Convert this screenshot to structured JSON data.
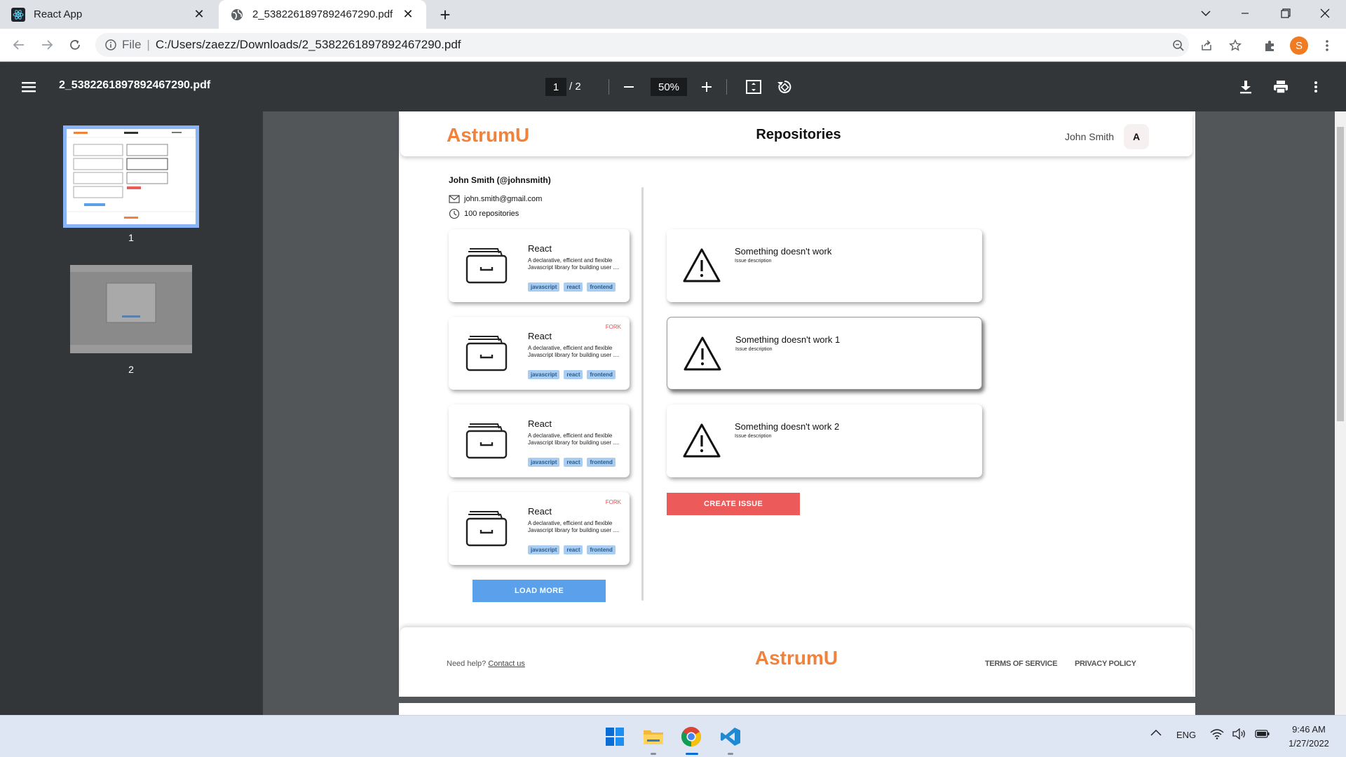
{
  "browser": {
    "tabs": [
      {
        "title": "React App",
        "active": false
      },
      {
        "title": "2_5382261897892467290.pdf",
        "active": true
      }
    ],
    "address": {
      "scheme_label": "File",
      "path": "C:/Users/zaezz/Downloads/2_5382261897892467290.pdf"
    },
    "profile_initial": "S"
  },
  "pdf_viewer": {
    "filename": "2_5382261897892467290.pdf",
    "current_page": "1",
    "total_pages": "/ 2",
    "zoom": "50%",
    "thumbnails": [
      {
        "label": "1",
        "selected": true
      },
      {
        "label": "2",
        "selected": false
      }
    ]
  },
  "document": {
    "header": {
      "logo": "AstrumU",
      "title": "Repositories",
      "user_name": "John Smith",
      "avatar_initial": "A"
    },
    "profile": {
      "name": "John Smith (@johnsmith)",
      "email": "john.smith@gmail.com",
      "repo_count": "100 repositories"
    },
    "repos": [
      {
        "name": "React",
        "description": "A declarative, efficient and flexible Javascript library for building user ....",
        "fork": "",
        "tags": [
          "javascript",
          "react",
          "frontend"
        ]
      },
      {
        "name": "React",
        "description": "A declarative, efficient and flexible Javascript library for building user ....",
        "fork": "FORK",
        "tags": [
          "javascript",
          "react",
          "frontend"
        ]
      },
      {
        "name": "React",
        "description": "A declarative, efficient and flexible Javascript library for building user ....",
        "fork": "",
        "tags": [
          "javascript",
          "react",
          "frontend"
        ]
      },
      {
        "name": "React",
        "description": "A declarative, efficient and flexible Javascript library for building user ....",
        "fork": "FORK",
        "tags": [
          "javascript",
          "react",
          "frontend"
        ]
      }
    ],
    "load_more": "LOAD MORE",
    "issues": [
      {
        "title": "Something doesn't work",
        "description": "Issue description"
      },
      {
        "title": "Something doesn't work 1",
        "description": "Issue description"
      },
      {
        "title": "Something doesn't work 2",
        "description": "Issue description"
      }
    ],
    "create_issue": "CREATE ISSUE",
    "footer": {
      "help_text": "Need help?",
      "help_link": "Contact us",
      "logo": "AstrumU",
      "terms": "TERMS OF SERVICE",
      "privacy": "PRIVACY POLICY"
    }
  },
  "taskbar": {
    "apps": [
      "start-icon",
      "file-explorer-icon",
      "chrome-icon",
      "vscode-icon"
    ],
    "language": "ENG",
    "time": "9:46 AM",
    "date": "1/27/2022"
  },
  "colors": {
    "brand_orange": "#f0823c",
    "tag_blue": "#a8cdf2",
    "create_red": "#ed5a5a",
    "load_blue": "#5aa0ea",
    "fork_red": "#e94a4a"
  }
}
